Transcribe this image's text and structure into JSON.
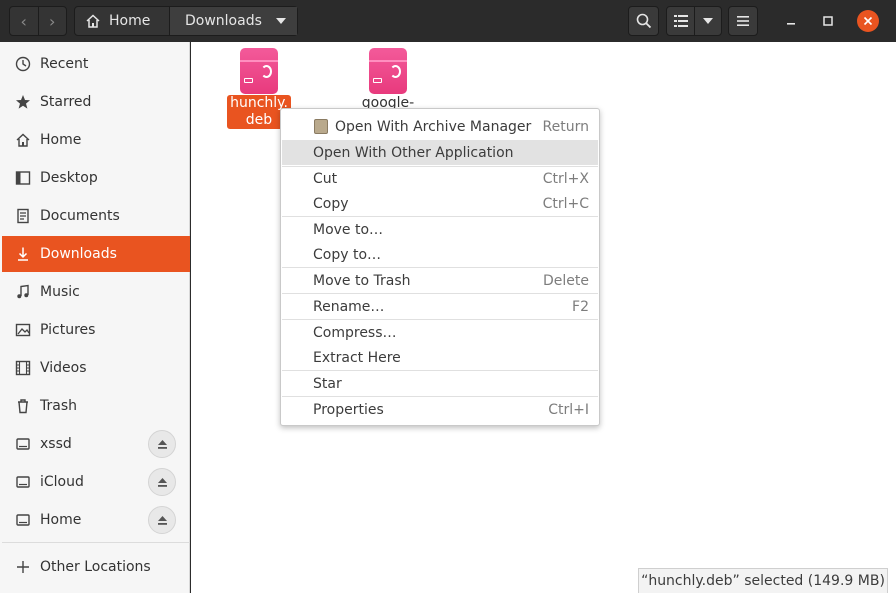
{
  "header": {
    "back_glyph": "‹",
    "forward_glyph": "›",
    "breadcrumb": [
      {
        "label": "Home",
        "icon": "home-icon"
      },
      {
        "label": "Downloads"
      }
    ],
    "buttons": [
      "search-icon",
      "list-view-icon",
      "chevron-down-icon",
      "menu-icon",
      "minimize-icon",
      "maximize-icon",
      "close-icon"
    ],
    "close_color": "#e95420"
  },
  "sidebar": {
    "items": [
      {
        "label": "Recent",
        "icon": "clock-icon"
      },
      {
        "label": "Starred",
        "icon": "star-icon"
      },
      {
        "label": "Home",
        "icon": "home-icon"
      },
      {
        "label": "Desktop",
        "icon": "desktop-icon"
      },
      {
        "label": "Documents",
        "icon": "document-icon"
      },
      {
        "label": "Downloads",
        "icon": "download-icon",
        "active": true
      },
      {
        "label": "Music",
        "icon": "music-icon"
      },
      {
        "label": "Pictures",
        "icon": "picture-icon"
      },
      {
        "label": "Videos",
        "icon": "video-icon"
      },
      {
        "label": "Trash",
        "icon": "trash-icon"
      },
      {
        "label": "xssd",
        "icon": "drive-icon",
        "eject": true
      },
      {
        "label": "iCloud",
        "icon": "drive-icon",
        "eject": true
      },
      {
        "label": "Home",
        "icon": "drive-icon",
        "eject": true
      }
    ],
    "other_locations": "Other Locations",
    "active_color": "#e95420"
  },
  "files": [
    {
      "line1": "hunchly.",
      "line2": "deb",
      "selected": true
    },
    {
      "line1": "google-",
      "line2": "",
      "selected": false
    }
  ],
  "context_menu": {
    "groups": [
      [
        {
          "label": "Open With Archive Manager",
          "accel": "Return",
          "icon": "archive-manager-icon"
        },
        {
          "label": "Open With Other Application",
          "accel": "",
          "hover": true
        }
      ],
      [
        {
          "label": "Cut",
          "accel": "Ctrl+X"
        },
        {
          "label": "Copy",
          "accel": "Ctrl+C"
        }
      ],
      [
        {
          "label": "Move to…",
          "accel": ""
        },
        {
          "label": "Copy to…",
          "accel": ""
        }
      ],
      [
        {
          "label": "Move to Trash",
          "accel": "Delete"
        }
      ],
      [
        {
          "label": "Rename…",
          "accel": "F2"
        }
      ],
      [
        {
          "label": "Compress…",
          "accel": ""
        },
        {
          "label": "Extract Here",
          "accel": ""
        }
      ],
      [
        {
          "label": "Star",
          "accel": ""
        }
      ],
      [
        {
          "label": "Properties",
          "accel": "Ctrl+I"
        }
      ]
    ]
  },
  "status": {
    "text": "“hunchly.deb” selected  (149.9 MB)"
  }
}
